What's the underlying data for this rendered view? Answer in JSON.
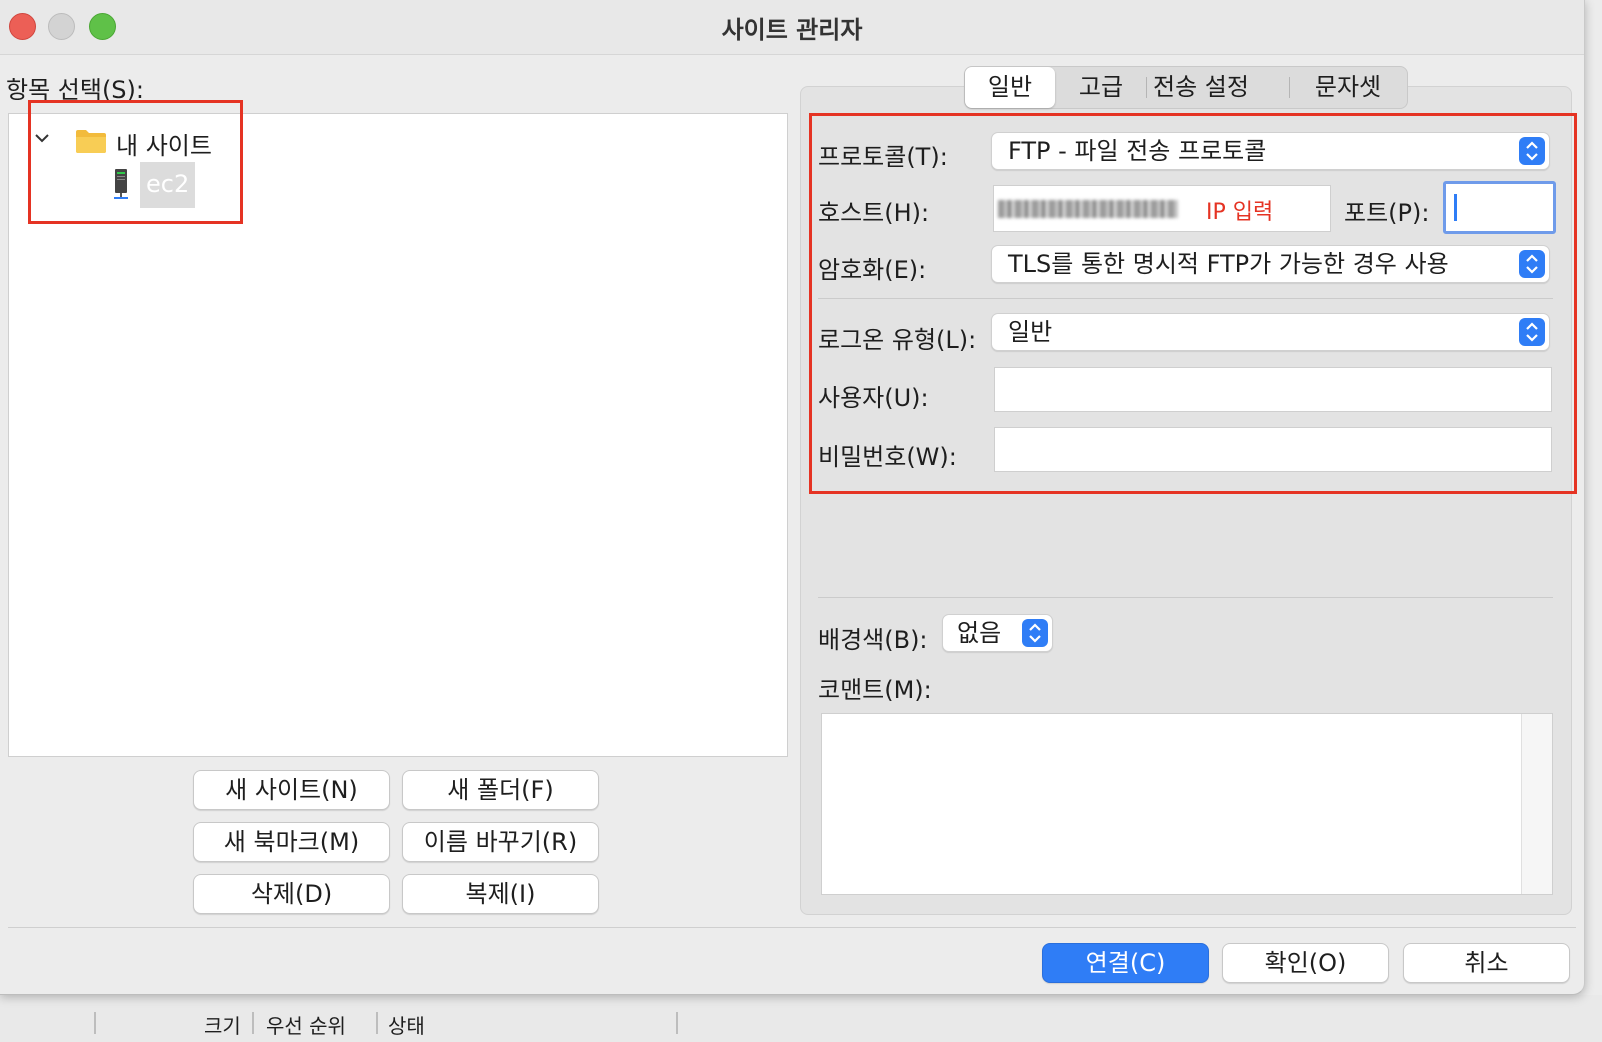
{
  "window": {
    "title": "사이트 관리자"
  },
  "left": {
    "select_label": "항목 선택(S):",
    "tree": {
      "folder_label": "내 사이트",
      "site_label": "ec2"
    },
    "buttons": {
      "new_site": "새 사이트(N)",
      "new_folder": "새 폴더(F)",
      "new_bookmark": "새 북마크(M)",
      "rename": "이름 바꾸기(R)",
      "delete": "삭제(D)",
      "duplicate": "복제(I)"
    }
  },
  "tabs": [
    "일반",
    "고급",
    "전송 설정",
    "문자셋"
  ],
  "general": {
    "protocol_label": "프로토콜(T):",
    "protocol_value": "FTP - 파일 전송 프로토콜",
    "host_label": "호스트(H):",
    "host_annotation": "IP 입력",
    "port_label": "포트(P):",
    "port_value": "",
    "encryption_label": "암호화(E):",
    "encryption_value": "TLS를 통한 명시적 FTP가 가능한 경우 사용",
    "logon_label": "로그온 유형(L):",
    "logon_value": "일반",
    "user_label": "사용자(U):",
    "user_value": "",
    "password_label": "비밀번호(W):",
    "password_value": "",
    "bgcolor_label": "배경색(B):",
    "bgcolor_value": "없음",
    "comment_label": "코맨트(M):",
    "comment_value": ""
  },
  "dialog_buttons": {
    "connect": "연결(C)",
    "ok": "확인(O)",
    "cancel": "취소"
  },
  "statusbar": {
    "columns": [
      "크기",
      "우선 순위",
      "상태"
    ]
  },
  "colors": {
    "accent": "#2f7df6",
    "highlight_annotation": "#e53323",
    "traffic_close": "#ec5f56",
    "traffic_max": "#5fc148"
  }
}
